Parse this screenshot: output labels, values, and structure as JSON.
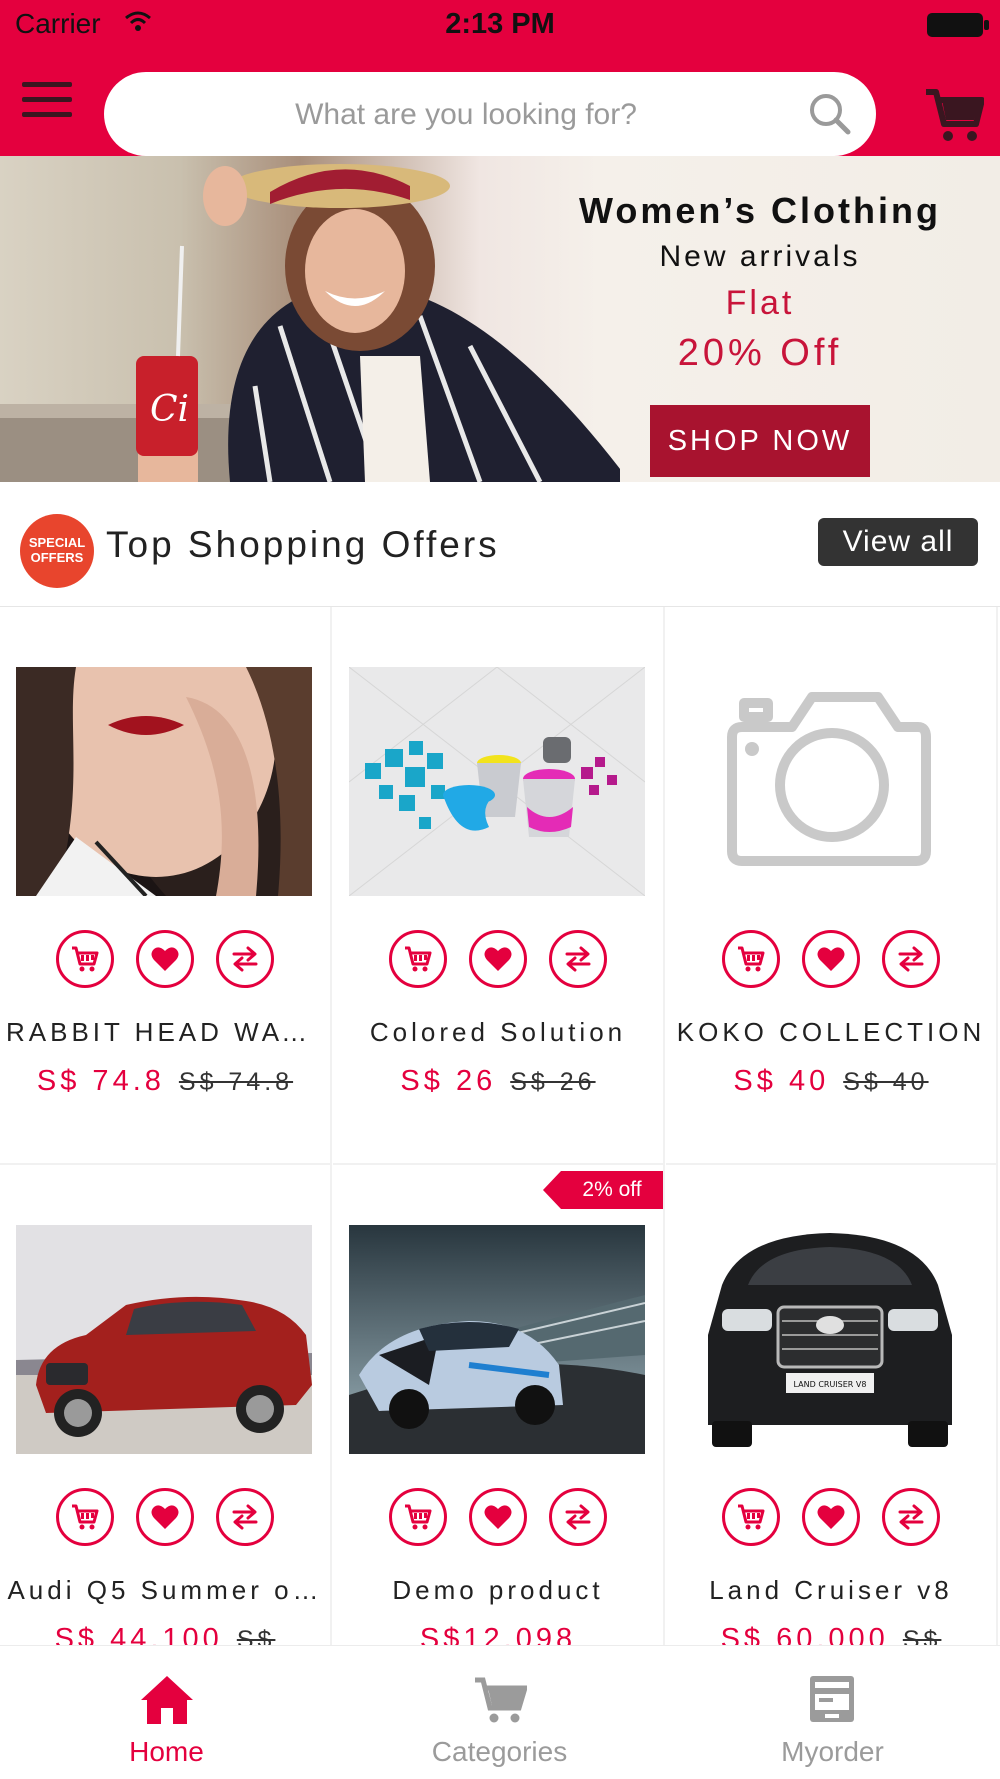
{
  "status_bar": {
    "carrier": "Carrier",
    "time": "2:13 PM"
  },
  "header": {
    "search_placeholder": "What are you looking for?"
  },
  "banner": {
    "title": "Women’s Clothing",
    "subtitle": "New arrivals",
    "offer_line1": "Flat",
    "offer_line2": "20% Off",
    "cta": "SHOP NOW"
  },
  "section": {
    "title": "Top Shopping Offers",
    "view_all": "View all",
    "badge_line1": "SPECIAL",
    "badge_line2": "OFFERS"
  },
  "products": [
    {
      "name": "RABBIT HEAD WAT…",
      "price": "S$ 74.8",
      "old_price": "S$ 74.8",
      "image": "woman-red-lips"
    },
    {
      "name": "Colored Solution",
      "price": "S$ 26",
      "old_price": "S$ 26",
      "image": "paint-cubes"
    },
    {
      "name": "KOKO COLLECTION",
      "price": "S$ 40",
      "old_price": "S$ 40",
      "image": "camera-placeholder"
    },
    {
      "name": "Audi Q5 Summer o…",
      "price": "S$ 44,100",
      "old_price": "S$",
      "image": "red-audi-suv"
    },
    {
      "name": "Demo product",
      "price": "S$12,098",
      "old_price": "",
      "badge": "2% off",
      "image": "blue-race-car"
    },
    {
      "name": "Land Cruiser v8",
      "price": "S$ 60,000",
      "old_price": "S$",
      "image": "black-land-cruiser"
    }
  ],
  "tabs": [
    {
      "label": "Home",
      "icon": "home-icon",
      "active": true
    },
    {
      "label": "Categories",
      "icon": "cart-icon",
      "active": false
    },
    {
      "label": "Myorder",
      "icon": "order-box-icon",
      "active": false
    }
  ],
  "colors": {
    "brand": "#e4003e",
    "banner_cta": "#a8132f",
    "view_all_bg": "#333333",
    "inactive_tab": "#9b9b9b"
  }
}
